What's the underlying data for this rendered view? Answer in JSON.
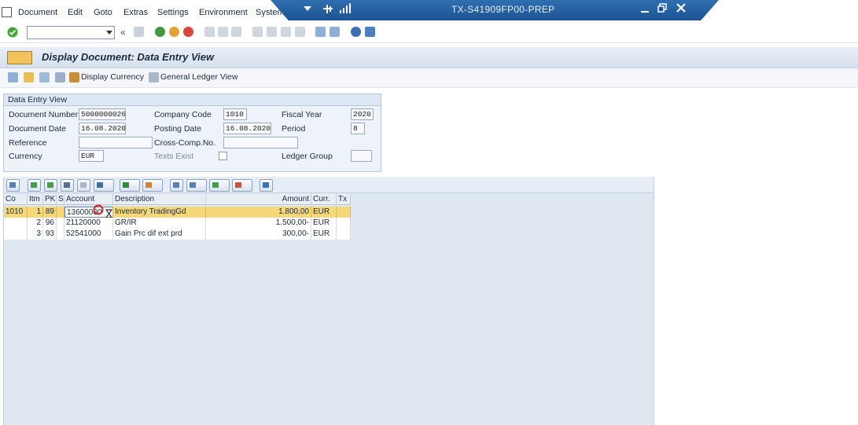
{
  "menu": [
    "Document",
    "Edit",
    "Goto",
    "Extras",
    "Settings",
    "Environment",
    "System"
  ],
  "window": {
    "title": "TX-S41909FP00-PREP"
  },
  "page_title": "Display Document: Data Entry View",
  "app_toolbar": {
    "display_currency": "Display Currency",
    "general_ledger_view": "General Ledger View"
  },
  "header": {
    "section_title": "Data Entry View",
    "document_number_label": "Document Number",
    "document_number": "5000000026",
    "company_code_label": "Company Code",
    "company_code": "1010",
    "fiscal_year_label": "Fiscal Year",
    "fiscal_year": "2020",
    "document_date_label": "Document Date",
    "document_date": "16.08.2020",
    "posting_date_label": "Posting Date",
    "posting_date": "16.08.2020",
    "period_label": "Period",
    "period": "8",
    "reference_label": "Reference",
    "reference": "",
    "cross_comp_label": "Cross-Comp.No.",
    "cross_comp": "",
    "currency_label": "Currency",
    "currency": "EUR",
    "texts_exist_label": "Texts Exist",
    "ledger_group_label": "Ledger Group",
    "ledger_group": ""
  },
  "grid": {
    "columns": [
      "Co",
      "Itm",
      "PK",
      "S",
      "Account",
      "Description",
      "Amount",
      "Curr.",
      "Tx"
    ],
    "rows": [
      {
        "co": "1010",
        "itm": "1",
        "pk": "89",
        "s": "",
        "account": "13600000",
        "description": "Inventory TradingGd",
        "amount": "1.800,00",
        "curr": "EUR",
        "tx": ""
      },
      {
        "co": "",
        "itm": "2",
        "pk": "96",
        "s": "",
        "account": "21120000",
        "description": "GR/IR",
        "amount": "1.500,00-",
        "curr": "EUR",
        "tx": ""
      },
      {
        "co": "",
        "itm": "3",
        "pk": "93",
        "s": "",
        "account": "52541000",
        "description": "Gain Prc dif ext prd",
        "amount": "300,00-",
        "curr": "EUR",
        "tx": ""
      }
    ]
  }
}
